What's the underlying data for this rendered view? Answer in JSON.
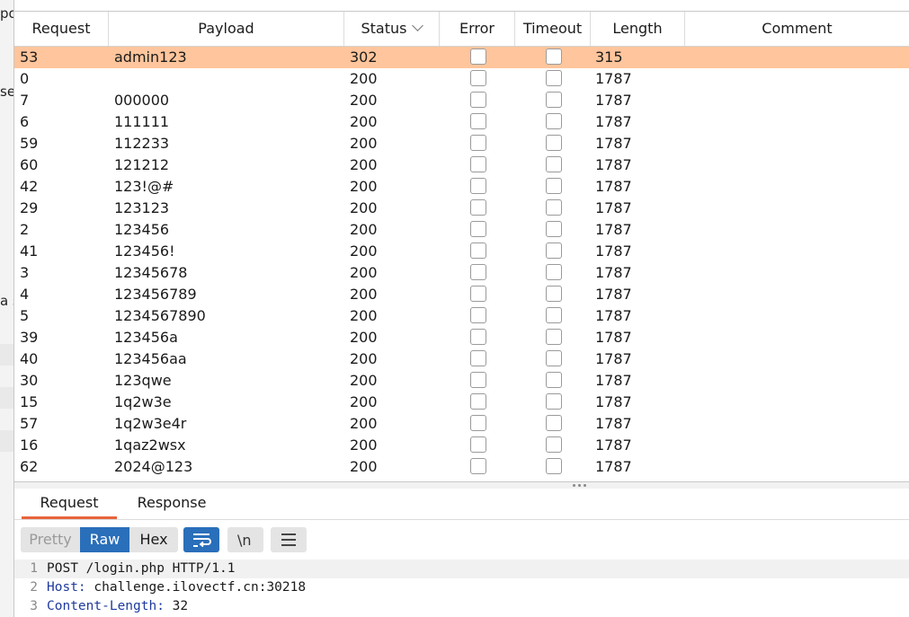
{
  "left_fragments": {
    "a": "po",
    "b": "se",
    "c": "a s"
  },
  "table": {
    "headers": {
      "request": "Request",
      "payload": "Payload",
      "status": "Status",
      "error": "Error",
      "timeout": "Timeout",
      "length": "Length",
      "comment": "Comment"
    },
    "sorted_column": "status",
    "selected_row_color": "#ffc59c",
    "rows": [
      {
        "request": "53",
        "payload": "admin123",
        "status": "302",
        "length": "315",
        "selected": true
      },
      {
        "request": "0",
        "payload": "",
        "status": "200",
        "length": "1787"
      },
      {
        "request": "7",
        "payload": "000000",
        "status": "200",
        "length": "1787"
      },
      {
        "request": "6",
        "payload": "111111",
        "status": "200",
        "length": "1787"
      },
      {
        "request": "59",
        "payload": "112233",
        "status": "200",
        "length": "1787"
      },
      {
        "request": "60",
        "payload": "121212",
        "status": "200",
        "length": "1787"
      },
      {
        "request": "42",
        "payload": "123!@#",
        "status": "200",
        "length": "1787"
      },
      {
        "request": "29",
        "payload": "123123",
        "status": "200",
        "length": "1787"
      },
      {
        "request": "2",
        "payload": "123456",
        "status": "200",
        "length": "1787"
      },
      {
        "request": "41",
        "payload": "123456!",
        "status": "200",
        "length": "1787"
      },
      {
        "request": "3",
        "payload": "12345678",
        "status": "200",
        "length": "1787"
      },
      {
        "request": "4",
        "payload": "123456789",
        "status": "200",
        "length": "1787"
      },
      {
        "request": "5",
        "payload": "1234567890",
        "status": "200",
        "length": "1787"
      },
      {
        "request": "39",
        "payload": "123456a",
        "status": "200",
        "length": "1787"
      },
      {
        "request": "40",
        "payload": "123456aa",
        "status": "200",
        "length": "1787"
      },
      {
        "request": "30",
        "payload": "123qwe",
        "status": "200",
        "length": "1787"
      },
      {
        "request": "15",
        "payload": "1q2w3e",
        "status": "200",
        "length": "1787"
      },
      {
        "request": "57",
        "payload": "1q2w3e4r",
        "status": "200",
        "length": "1787"
      },
      {
        "request": "16",
        "payload": "1qaz2wsx",
        "status": "200",
        "length": "1787"
      },
      {
        "request": "62",
        "payload": "2024@123",
        "status": "200",
        "length": "1787"
      }
    ]
  },
  "tabs": {
    "request": "Request",
    "response": "Response",
    "active": "request"
  },
  "toolbar": {
    "pretty": "Pretty",
    "raw": "Raw",
    "hex": "Hex",
    "active_view": "raw",
    "wrap_icon": "wrap-lines-icon",
    "newline_icon": "newline-icon",
    "menu_icon": "hamburger-menu-icon",
    "accent": "#2a6fba"
  },
  "editor": {
    "lines": [
      {
        "no": "1",
        "key": "",
        "value": "POST /login.php HTTP/1.1"
      },
      {
        "no": "2",
        "key": "Host:",
        "value": " challenge.ilovectf.cn:30218"
      },
      {
        "no": "3",
        "key": "Content-Length:",
        "value": " 32"
      }
    ]
  }
}
